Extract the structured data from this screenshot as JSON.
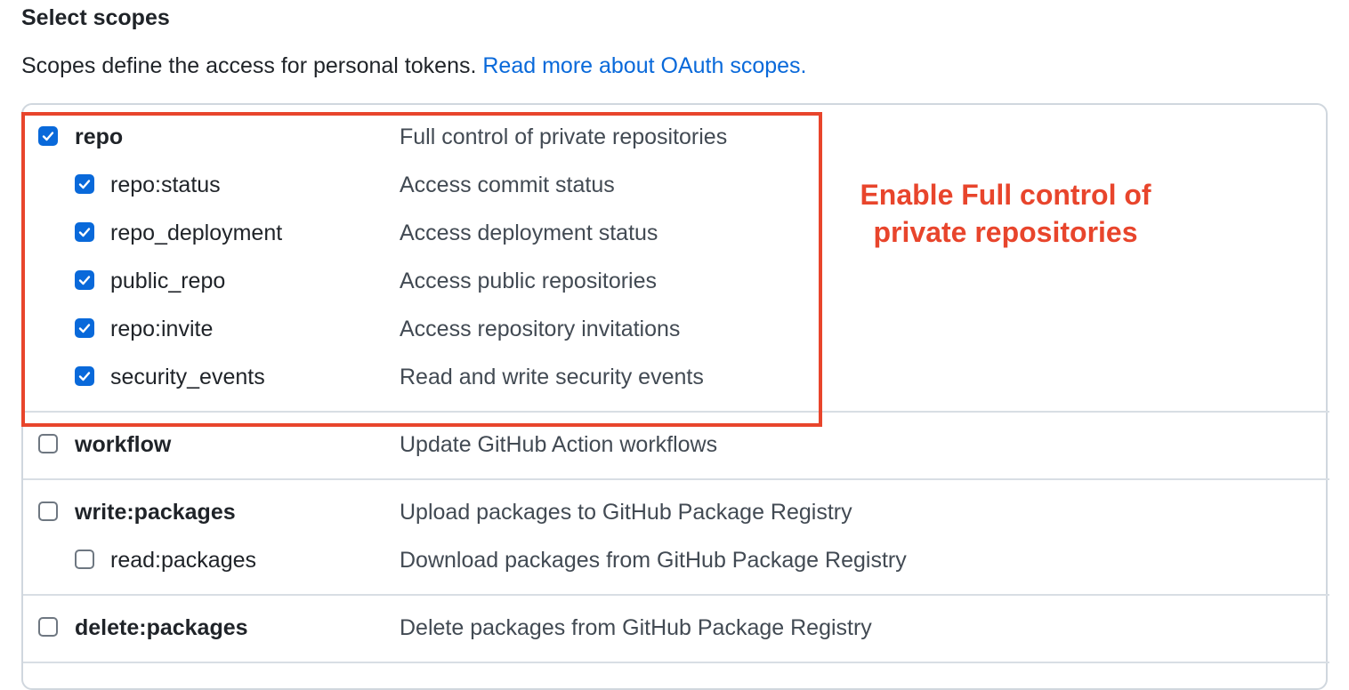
{
  "heading": "Select scopes",
  "intro": {
    "text": "Scopes define the access for personal tokens.",
    "link": "Read more about OAuth scopes."
  },
  "scopes": [
    {
      "name": "repo",
      "description": "Full control of private repositories",
      "checked": true,
      "level": 0
    },
    {
      "name": "repo:status",
      "description": "Access commit status",
      "checked": true,
      "level": 1
    },
    {
      "name": "repo_deployment",
      "description": "Access deployment status",
      "checked": true,
      "level": 1
    },
    {
      "name": "public_repo",
      "description": "Access public repositories",
      "checked": true,
      "level": 1
    },
    {
      "name": "repo:invite",
      "description": "Access repository invitations",
      "checked": true,
      "level": 1
    },
    {
      "name": "security_events",
      "description": "Read and write security events",
      "checked": true,
      "level": 1
    },
    {
      "name": "workflow",
      "description": "Update GitHub Action workflows",
      "checked": false,
      "level": 0
    },
    {
      "name": "write:packages",
      "description": "Upload packages to GitHub Package Registry",
      "checked": false,
      "level": 0
    },
    {
      "name": "read:packages",
      "description": "Download packages from GitHub Package Registry",
      "checked": false,
      "level": 1
    },
    {
      "name": "delete:packages",
      "description": "Delete packages from GitHub Package Registry",
      "checked": false,
      "level": 0
    }
  ],
  "annotation": {
    "line1": "Enable Full control of",
    "line2": "private repositories",
    "color": "#e8452c"
  },
  "colors": {
    "checkbox_checked": "#0969da",
    "link": "#0969da"
  }
}
